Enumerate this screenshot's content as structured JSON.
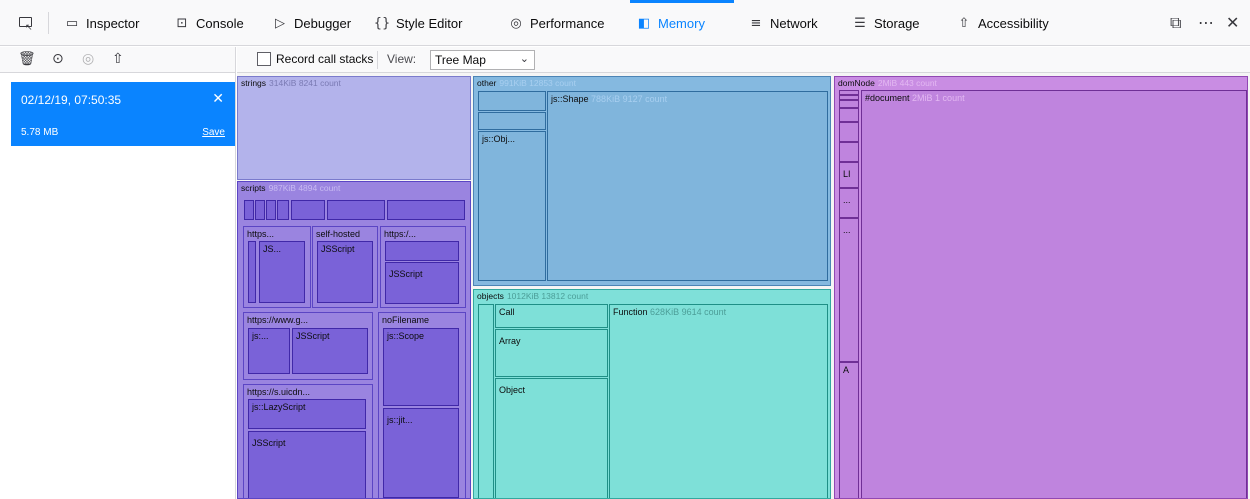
{
  "toolbar": {
    "tabs": [
      {
        "label": "Inspector",
        "icon": "inspector-icon"
      },
      {
        "label": "Console",
        "icon": "console-icon"
      },
      {
        "label": "Debugger",
        "icon": "debugger-icon"
      },
      {
        "label": "Style Editor",
        "icon": "style-editor-icon"
      },
      {
        "label": "Performance",
        "icon": "performance-icon"
      },
      {
        "label": "Memory",
        "icon": "memory-icon"
      },
      {
        "label": "Network",
        "icon": "network-icon"
      },
      {
        "label": "Storage",
        "icon": "storage-icon"
      },
      {
        "label": "Accessibility",
        "icon": "accessibility-icon"
      }
    ],
    "active_tab": "Memory"
  },
  "snapshot": {
    "date": "02/12/19, 07:50:35",
    "size": "5.78 MB",
    "save_label": "Save"
  },
  "memory_toolbar": {
    "record_label": "Record call stacks",
    "view_label": "View:",
    "view_value": "Tree Map"
  },
  "treemap": {
    "strings": {
      "name": "strings",
      "meta": "314KiB 8241 count"
    },
    "scripts": {
      "name": "scripts",
      "meta": "987KiB 4894 count"
    },
    "other": {
      "name": "other",
      "meta": "991KiB 12853 count"
    },
    "objects": {
      "name": "objects",
      "meta": "1012KiB 13812 count"
    },
    "domNode": {
      "name": "domNode",
      "meta": "2MiB 443 count"
    },
    "other_cells": {
      "shape": "js::Shape",
      "shape_meta": "788KiB 9127 count",
      "obj": "js::Obj..."
    },
    "scripts_cells": {
      "https1": "https...",
      "js1": "JS...",
      "selfhosted": "self-hosted",
      "jsscript1": "JSScript",
      "https2": "https:/...",
      "jsscript2": "JSScript",
      "httpswww": "https://www.g...",
      "js2": "js:...",
      "jsscript3": "JSScript",
      "nofilename": "noFilename",
      "scope": "js::Scope",
      "jit": "js::jit...",
      "httpss": "https://s.uicdn...",
      "lazyscript": "js::LazyScript",
      "jsscript4": "JSScript"
    },
    "objects_cells": {
      "call": "Call",
      "array": "Array",
      "object": "Object",
      "function": "Function",
      "function_meta": "628KiB 9614 count"
    },
    "dom_cells": {
      "document": "#document",
      "document_meta": "2MiB 1 count",
      "li": "LI",
      "dots1": "...",
      "dots2": "...",
      "a": "A"
    }
  }
}
